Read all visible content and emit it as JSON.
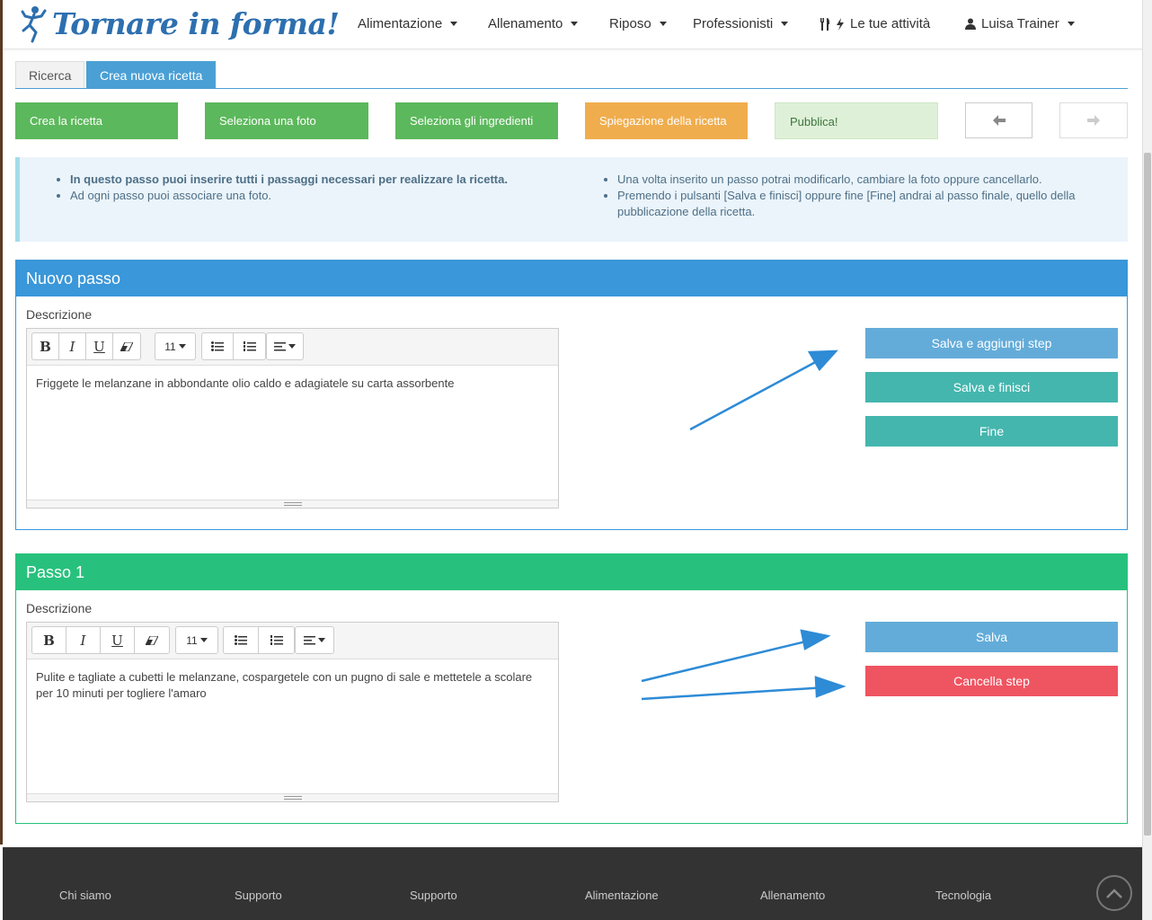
{
  "brand": {
    "name": "Tornare in forma!"
  },
  "nav": {
    "items": [
      {
        "label": "Alimentazione"
      },
      {
        "label": "Allenamento"
      },
      {
        "label": "Riposo"
      },
      {
        "label": "Professionisti"
      }
    ],
    "activities": "Le tue attività",
    "user": "Luisa Trainer"
  },
  "tabs": [
    "Ricerca",
    "Crea nuova ricetta"
  ],
  "wizard": {
    "steps": [
      "Crea la ricetta",
      "Seleziona una foto",
      "Seleziona gli ingredienti",
      "Spiegazione della ricetta",
      "Pubblica!"
    ],
    "colors": {
      "done": "#5cb85c",
      "current": "#f0ad4e",
      "pending": "#dff0d8"
    }
  },
  "info": {
    "left": [
      "In questo passo puoi inserire tutti i passaggi necessari per realizzare la ricetta.",
      "Ad ogni passo puoi associare una foto."
    ],
    "right": [
      "Una volta inserito un passo potrai modificarlo, cambiare la foto oppure cancellarlo.",
      "Premendo i pulsanti [Salva e finisci] oppure fine [Fine] andrai al passo finale, quello della pubblicazione della ricetta."
    ]
  },
  "new_step": {
    "title": "Nuovo passo",
    "label": "Descrizione",
    "font_size": "11",
    "text": "Friggete le melanzane in abbondante olio caldo e adagiatele su carta assorbente",
    "buttons": [
      "Salva e aggiungi step",
      "Salva e finisci",
      "Fine"
    ],
    "color": "#3a97d9"
  },
  "step1": {
    "title": "Passo 1",
    "label": "Descrizione",
    "font_size": "11",
    "text": "Pulite e tagliate a cubetti le melanzane, cospargetele con un pugno di sale e mettetele a scolare per 10 minuti per togliere l'amaro",
    "buttons": [
      "Salva",
      "Cancella step"
    ],
    "color": "#27c17d"
  },
  "footer": {
    "links": [
      "Chi siamo",
      "Supporto",
      "Supporto",
      "Alimentazione",
      "Allenamento",
      "Tecnologia"
    ]
  }
}
